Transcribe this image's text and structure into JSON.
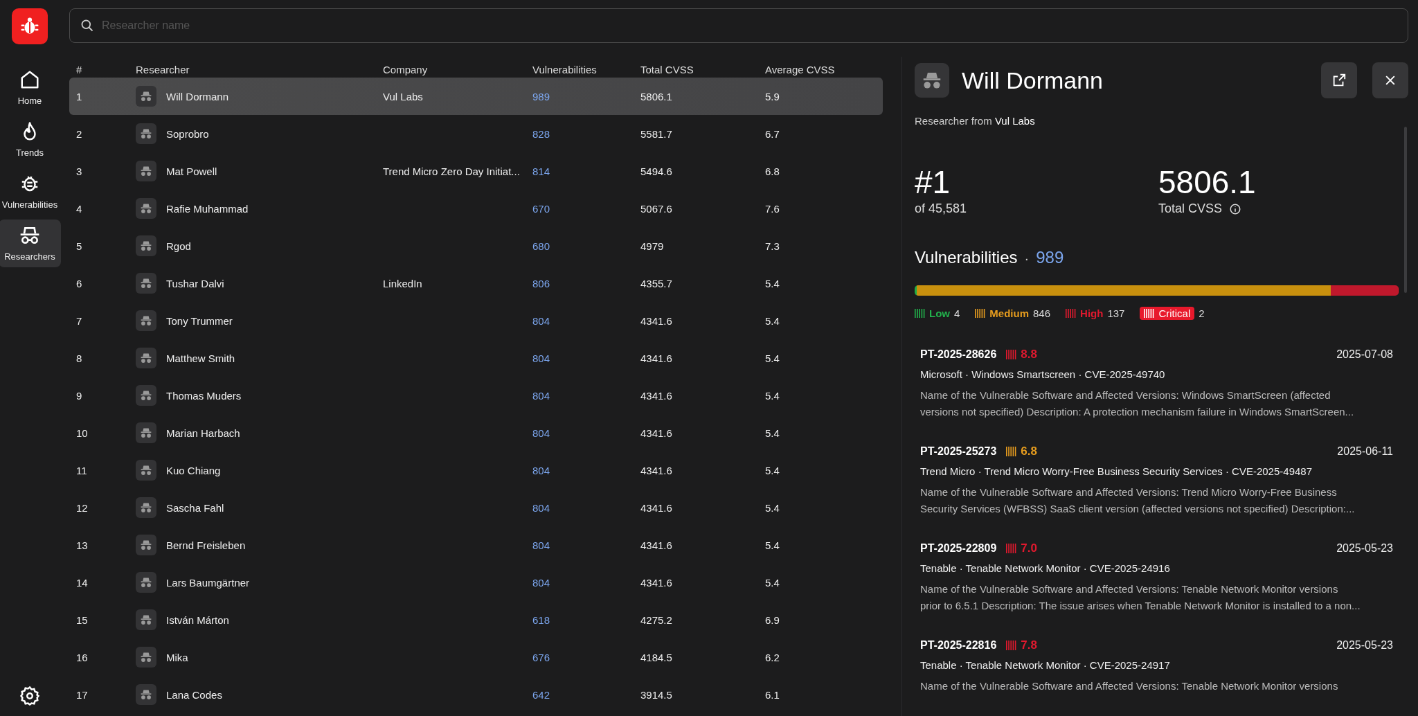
{
  "sidebar": {
    "items": [
      {
        "label": "Home",
        "kind": "home",
        "selected": false
      },
      {
        "label": "Trends",
        "kind": "flame",
        "selected": false
      },
      {
        "label": "Vulnerabilities",
        "kind": "bug",
        "selected": false
      },
      {
        "label": "Researchers",
        "kind": "incognito",
        "selected": true
      }
    ]
  },
  "search": {
    "placeholder": "Researcher name"
  },
  "table": {
    "columns": [
      "#",
      "Researcher",
      "Company",
      "Vulnerabilities",
      "Total CVSS",
      "Average CVSS"
    ],
    "rows": [
      {
        "rank": "1",
        "name": "Will Dormann",
        "company": "Vul Labs",
        "vulnerabilities": "989",
        "total_cvss": "5806.1",
        "average_cvss": "5.9",
        "selected": true
      },
      {
        "rank": "2",
        "name": "Soprobro",
        "vulnerabilities": "828",
        "total_cvss": "5581.7",
        "average_cvss": "6.7",
        "selected": false
      },
      {
        "rank": "3",
        "name": "Mat Powell",
        "company": "Trend Micro Zero Day Initiat...",
        "vulnerabilities": "814",
        "total_cvss": "5494.6",
        "average_cvss": "6.8",
        "selected": false
      },
      {
        "rank": "4",
        "name": "Rafie Muhammad",
        "vulnerabilities": "670",
        "total_cvss": "5067.6",
        "average_cvss": "7.6",
        "selected": false
      },
      {
        "rank": "5",
        "name": "Rgod",
        "vulnerabilities": "680",
        "total_cvss": "4979",
        "average_cvss": "7.3",
        "selected": false
      },
      {
        "rank": "6",
        "name": "Tushar Dalvi",
        "company": "LinkedIn",
        "vulnerabilities": "806",
        "total_cvss": "4355.7",
        "average_cvss": "5.4",
        "selected": false
      },
      {
        "rank": "7",
        "name": "Tony Trummer",
        "vulnerabilities": "804",
        "total_cvss": "4341.6",
        "average_cvss": "5.4",
        "selected": false
      },
      {
        "rank": "8",
        "name": "Matthew Smith",
        "vulnerabilities": "804",
        "total_cvss": "4341.6",
        "average_cvss": "5.4",
        "selected": false
      },
      {
        "rank": "9",
        "name": "Thomas Muders",
        "vulnerabilities": "804",
        "total_cvss": "4341.6",
        "average_cvss": "5.4",
        "selected": false
      },
      {
        "rank": "10",
        "name": "Marian Harbach",
        "vulnerabilities": "804",
        "total_cvss": "4341.6",
        "average_cvss": "5.4",
        "selected": false
      },
      {
        "rank": "11",
        "name": "Kuo Chiang",
        "vulnerabilities": "804",
        "total_cvss": "4341.6",
        "average_cvss": "5.4",
        "selected": false
      },
      {
        "rank": "12",
        "name": "Sascha Fahl",
        "vulnerabilities": "804",
        "total_cvss": "4341.6",
        "average_cvss": "5.4",
        "selected": false
      },
      {
        "rank": "13",
        "name": "Bernd Freisleben",
        "vulnerabilities": "804",
        "total_cvss": "4341.6",
        "average_cvss": "5.4",
        "selected": false
      },
      {
        "rank": "14",
        "name": "Lars Baumgärtner",
        "vulnerabilities": "804",
        "total_cvss": "4341.6",
        "average_cvss": "5.4",
        "selected": false
      },
      {
        "rank": "15",
        "name": "István Márton",
        "vulnerabilities": "618",
        "total_cvss": "4275.2",
        "average_cvss": "6.9",
        "selected": false
      },
      {
        "rank": "16",
        "name": "Mika",
        "vulnerabilities": "676",
        "total_cvss": "4184.5",
        "average_cvss": "6.2",
        "selected": false
      },
      {
        "rank": "17",
        "name": "Lana Codes",
        "vulnerabilities": "642",
        "total_cvss": "3914.5",
        "average_cvss": "6.1",
        "selected": false
      }
    ]
  },
  "detail": {
    "name": "Will Dormann",
    "subtitle": "Researcher from **Vul Labs**",
    "rank": "#1",
    "rank_of": "of 45,581",
    "total_cvss": "5806.1",
    "total_cvss_label": "Total CVSS",
    "vulnerabilities_label": "Vulnerabilities",
    "separator": "·",
    "vulnerabilities_count": "989",
    "severities": [
      {
        "kind": "low",
        "label": "Low",
        "count": "4",
        "color": "#1fae45"
      },
      {
        "kind": "medium",
        "label": "Medium",
        "count": "846",
        "color": "#c8900e"
      },
      {
        "kind": "high",
        "label": "High",
        "count": "137",
        "color": "#c0182c"
      },
      {
        "kind": "critical",
        "label": "Critical",
        "count": "2",
        "color": "#e8192c"
      }
    ],
    "entries": [
      {
        "id": "PT-2025-28626",
        "kind": "high",
        "score": "8.8",
        "date": "2025-07-08",
        "meta": "Microsoft · Windows Smartscreen · CVE-2025-49740",
        "lines": [
          "Name of the Vulnerable Software and Affected Versions: Windows SmartScreen (affected",
          "versions not specified) Description: A protection mechanism failure in Windows SmartScreen..."
        ]
      },
      {
        "id": "PT-2025-25273",
        "kind": "medium",
        "score": "6.8",
        "date": "2025-06-11",
        "meta": "Trend Micro · Trend Micro Worry-Free Business Security Services · CVE-2025-49487",
        "lines": [
          "Name of the Vulnerable Software and Affected Versions: Trend Micro Worry-Free Business",
          "Security Services (WFBSS) SaaS client version (affected versions not specified) Description:..."
        ]
      },
      {
        "id": "PT-2025-22809",
        "kind": "high",
        "score": "7.0",
        "date": "2025-05-23",
        "meta": "Tenable · Tenable Network Monitor · CVE-2025-24916",
        "lines": [
          "Name of the Vulnerable Software and Affected Versions: Tenable Network Monitor versions",
          "prior to 6.5.1 Description: The issue arises when Tenable Network Monitor is installed to a non..."
        ]
      },
      {
        "id": "PT-2025-22816",
        "kind": "high",
        "score": "7.8",
        "date": "2025-05-23",
        "meta": "Tenable · Tenable Network Monitor · CVE-2025-24917",
        "lines": [
          "Name of the Vulnerable Software and Affected Versions: Tenable Network Monitor versions"
        ]
      }
    ]
  }
}
